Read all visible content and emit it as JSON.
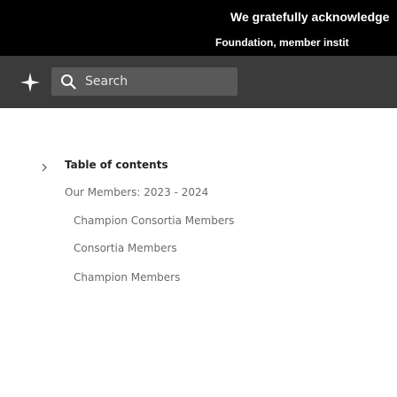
{
  "banner": {
    "line1": "We gratefully acknowledge",
    "line2": "Foundation, member instit"
  },
  "header": {
    "logo_icon": "diamond-logo-icon",
    "search": {
      "icon": "search-icon",
      "label": "Search"
    }
  },
  "toc": {
    "collapse_icon": "chevron-right-icon",
    "title": "Table of contents",
    "items": [
      {
        "label": "Our Members: 2023 - 2024"
      },
      {
        "label": "Champion Consortia Members"
      },
      {
        "label": "Consortia Members"
      },
      {
        "label": "Champion Members"
      }
    ]
  },
  "colors": {
    "banner_bg": "#000000",
    "header_bg": "#3b3b3b",
    "search_bg": "#595959",
    "toc_text": "#6b6b6b"
  }
}
